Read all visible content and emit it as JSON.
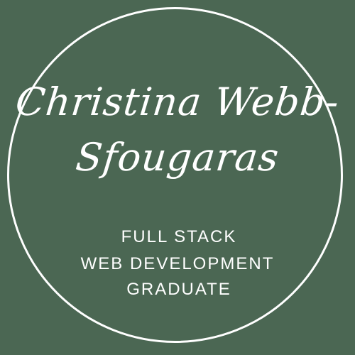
{
  "logo": {
    "name_line_1": "Christina Webb-",
    "name_line_2": "Sfougaras",
    "tagline": [
      "FULL STACK",
      "WEB DEVELOPMENT",
      "GRADUATE"
    ],
    "colors": {
      "background": "#4b6753",
      "foreground": "#ffffff"
    }
  }
}
